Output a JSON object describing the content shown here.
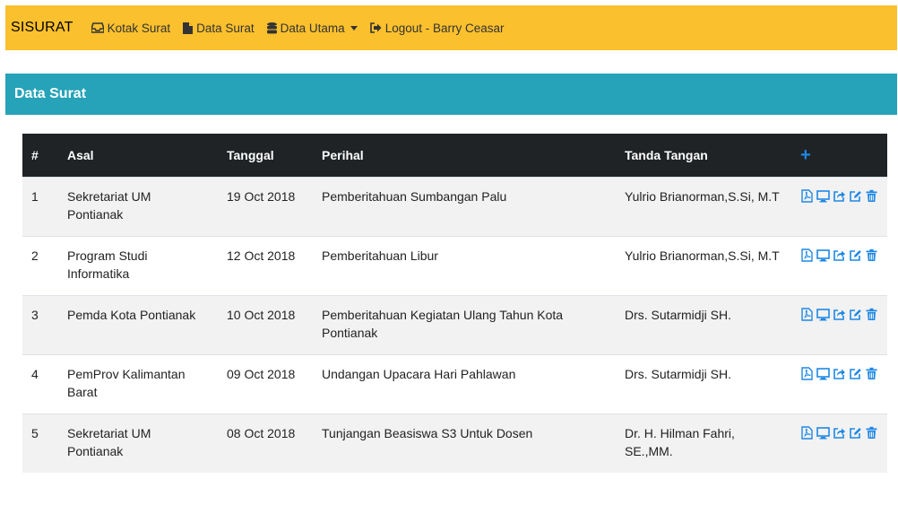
{
  "navbar": {
    "brand": "SISURAT",
    "items": [
      {
        "label": "Kotak Surat",
        "icon": "inbox-icon"
      },
      {
        "label": "Data Surat",
        "icon": "file-icon"
      },
      {
        "label": "Data Utama",
        "icon": "database-icon"
      },
      {
        "label": "Logout - Barry Ceasar",
        "icon": "sign-out-icon"
      }
    ]
  },
  "card": {
    "title": "Data Surat"
  },
  "table": {
    "headers": {
      "no": "#",
      "asal": "Asal",
      "tanggal": "Tanggal",
      "perihal": "Perihal",
      "ttd": "Tanda Tangan",
      "add": "+"
    },
    "rows": [
      {
        "no": "1",
        "asal": "Sekretariat UM Pontianak",
        "tanggal": "19 Oct 2018",
        "perihal": "Pemberitahuan Sumbangan Palu",
        "ttd": "Yulrio Brianorman,S.Si, M.T"
      },
      {
        "no": "2",
        "asal": "Program Studi Informatika",
        "tanggal": "12 Oct 2018",
        "perihal": "Pemberitahuan Libur",
        "ttd": "Yulrio Brianorman,S.Si, M.T"
      },
      {
        "no": "3",
        "asal": "Pemda Kota Pontianak",
        "tanggal": "10 Oct 2018",
        "perihal": "Pemberitahuan Kegiatan Ulang Tahun Kota Pontianak",
        "ttd": "Drs. Sutarmidji SH."
      },
      {
        "no": "4",
        "asal": "PemProv Kalimantan Barat",
        "tanggal": "09 Oct 2018",
        "perihal": "Undangan Upacara Hari Pahlawan",
        "ttd": "Drs. Sutarmidji SH."
      },
      {
        "no": "5",
        "asal": "Sekretariat UM Pontianak",
        "tanggal": "08 Oct 2018",
        "perihal": "Tunjangan Beasiswa S3 Untuk Dosen",
        "ttd": "Dr. H. Hilman Fahri, SE.,MM."
      }
    ],
    "row_actions": [
      "pdf-icon",
      "desktop-icon",
      "share-icon",
      "edit-icon",
      "trash-icon"
    ]
  },
  "colors": {
    "navbar": "#fbc02d",
    "header": "#26a3b8",
    "thead": "#1f2326",
    "action": "#1e88e5"
  }
}
